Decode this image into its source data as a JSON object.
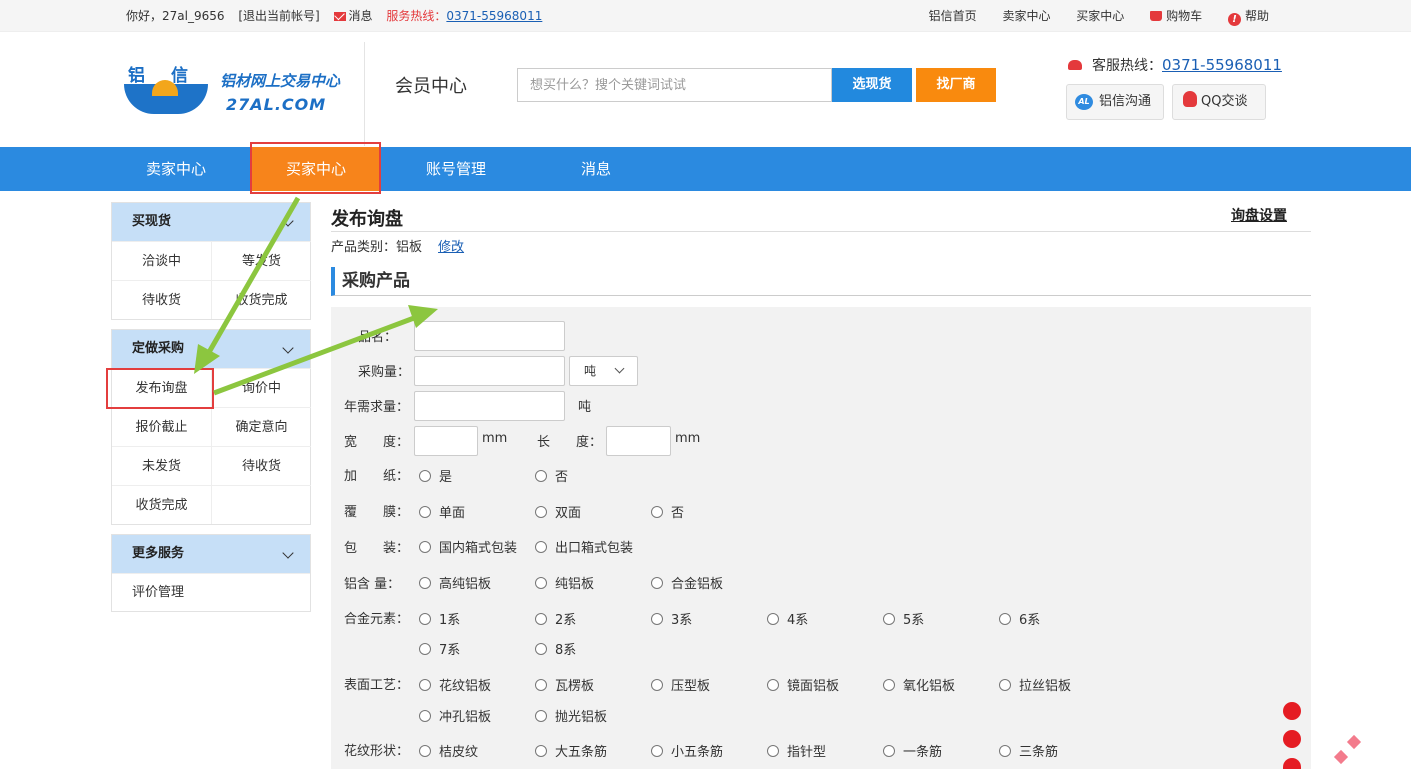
{
  "topbar": {
    "greeting": "你好，27al_9656",
    "logout": "[退出当前帐号]",
    "message": "消息",
    "hotline_label": "服务热线：",
    "hotline_number": "0371-55968011",
    "links": [
      "铝信首页",
      "卖家中心",
      "买家中心",
      "购物车",
      "帮助"
    ]
  },
  "header": {
    "logo_cn": "铝信",
    "slogan": "铝材网上交易中心",
    "domain": "27AL.COM",
    "member_center": "会员中心",
    "search_placeholder": "想买什么？搜个关键词试试",
    "btn_spot": "选现货",
    "btn_factory": "找厂商",
    "service_label": "客服热线：",
    "service_number": "0371-55968011",
    "chat_al": "铝信沟通",
    "chat_qq": "QQ交谈"
  },
  "nav": {
    "items": [
      "卖家中心",
      "买家中心",
      "账号管理",
      "消息"
    ],
    "active_index": 1
  },
  "sidebar": {
    "groups": [
      {
        "title": "买现货",
        "items": [
          "洽谈中",
          "等发货",
          "待收货",
          "收货完成"
        ]
      },
      {
        "title": "定做采购",
        "items": [
          "发布询盘",
          "询价中",
          "报价截止",
          "确定意向",
          "未发货",
          "待收货",
          "收货完成",
          ""
        ]
      },
      {
        "title": "更多服务",
        "items": [
          "评价管理"
        ]
      }
    ]
  },
  "main": {
    "title": "发布询盘",
    "settings": "询盘设置",
    "category_label": "产品类别：",
    "category_value": "铝板",
    "edit": "修改",
    "section": "采购产品",
    "form": {
      "name_label": "品名：",
      "qty_label": "采购量：",
      "qty_unit": "吨",
      "annual_label": "年需求量：",
      "annual_unit": "吨",
      "width_label": "宽　　度：",
      "width_unit": "mm",
      "length_label": "长　　度：",
      "length_unit": "mm",
      "paper_label": "加　　纸：",
      "paper_opts": [
        "是",
        "否"
      ],
      "film_label": "覆　　膜：",
      "film_opts": [
        "单面",
        "双面",
        "否"
      ],
      "pack_label": "包　　装：",
      "pack_opts": [
        "国内箱式包装",
        "出口箱式包装"
      ],
      "al_label": "铝含 量：",
      "al_opts": [
        "高纯铝板",
        "纯铝板",
        "合金铝板"
      ],
      "alloy_label": "合金元素：",
      "alloy_opts": [
        "1系",
        "2系",
        "3系",
        "4系",
        "5系",
        "6系",
        "7系",
        "8系"
      ],
      "surface_label": "表面工艺：",
      "surface_opts": [
        "花纹铝板",
        "瓦楞板",
        "压型板",
        "镜面铝板",
        "氧化铝板",
        "拉丝铝板",
        "冲孔铝板",
        "抛光铝板"
      ],
      "pattern_label": "花纹形状：",
      "pattern_opts": [
        "桔皮纹",
        "大五条筋",
        "小五条筋",
        "指针型",
        "一条筋",
        "三条筋"
      ]
    }
  },
  "colors": {
    "nav_blue": "#2b8ae0",
    "active_orange": "#f7841b",
    "highlight_red": "#e33e3e",
    "arrow_green": "#8cc63f"
  }
}
